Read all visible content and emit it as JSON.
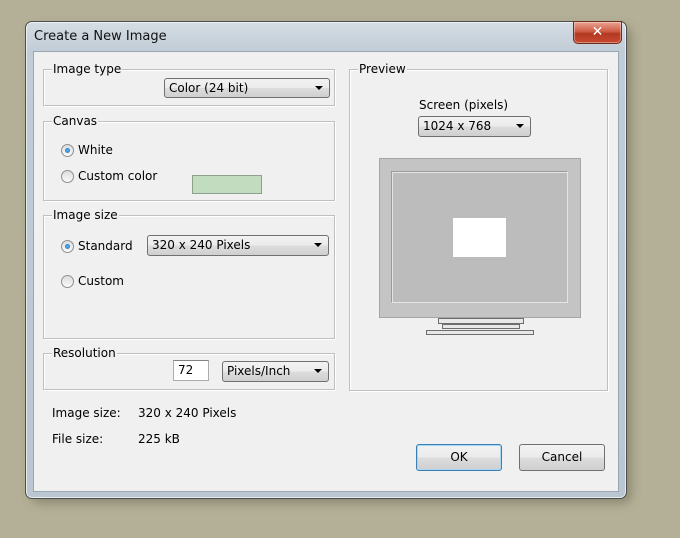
{
  "window": {
    "title": "Create a New Image",
    "close_glyph": "✕"
  },
  "image_type": {
    "legend": "Image type",
    "selected": "Color (24 bit)"
  },
  "canvas": {
    "legend": "Canvas",
    "white_label": "White",
    "white_checked": true,
    "custom_label": "Custom color",
    "custom_checked": false,
    "custom_color": "#c2dcc0"
  },
  "image_size": {
    "legend": "Image size",
    "standard_label": "Standard",
    "standard_checked": true,
    "standard_selected": "320 x 240 Pixels",
    "custom_label": "Custom",
    "custom_checked": false
  },
  "resolution": {
    "legend": "Resolution",
    "value": "72",
    "unit_selected": "Pixels/Inch"
  },
  "preview": {
    "legend": "Preview",
    "screen_label": "Screen (pixels)",
    "screen_selected": "1024 x 768"
  },
  "info": {
    "image_size_label": "Image size:",
    "image_size_value": "320 x 240 Pixels",
    "file_size_label": "File size:",
    "file_size_value": "225 kB"
  },
  "buttons": {
    "ok": "OK",
    "cancel": "Cancel"
  },
  "colors": {
    "desktop": "#b4b097",
    "dialog_face": "#f0f0f0",
    "radio_accent": "#1467b4",
    "close_button": "#c94a30"
  }
}
